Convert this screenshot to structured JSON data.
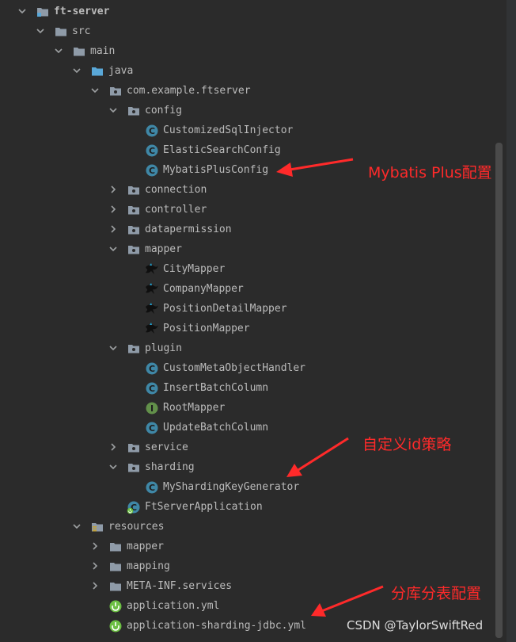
{
  "tree": [
    {
      "label": "ft-server",
      "level": 0,
      "type": "module",
      "expanded": true,
      "bold": true
    },
    {
      "label": "src",
      "level": 1,
      "type": "folder",
      "expanded": true
    },
    {
      "label": "main",
      "level": 2,
      "type": "folder",
      "expanded": true
    },
    {
      "label": "java",
      "level": 3,
      "type": "source-folder",
      "expanded": true
    },
    {
      "label": "com.example.ftserver",
      "level": 4,
      "type": "package",
      "expanded": true
    },
    {
      "label": "config",
      "level": 5,
      "type": "package",
      "expanded": true
    },
    {
      "label": "CustomizedSqlInjector",
      "level": 6,
      "type": "class"
    },
    {
      "label": "ElasticSearchConfig",
      "level": 6,
      "type": "class"
    },
    {
      "label": "MybatisPlusConfig",
      "level": 6,
      "type": "class"
    },
    {
      "label": "connection",
      "level": 5,
      "type": "package",
      "expanded": false
    },
    {
      "label": "controller",
      "level": 5,
      "type": "package",
      "expanded": false
    },
    {
      "label": "datapermission",
      "level": 5,
      "type": "package",
      "expanded": false
    },
    {
      "label": "mapper",
      "level": 5,
      "type": "package",
      "expanded": true
    },
    {
      "label": "CityMapper",
      "level": 6,
      "type": "mybatis"
    },
    {
      "label": "CompanyMapper",
      "level": 6,
      "type": "mybatis"
    },
    {
      "label": "PositionDetailMapper",
      "level": 6,
      "type": "mybatis"
    },
    {
      "label": "PositionMapper",
      "level": 6,
      "type": "mybatis"
    },
    {
      "label": "plugin",
      "level": 5,
      "type": "package",
      "expanded": true
    },
    {
      "label": "CustomMetaObjectHandler",
      "level": 6,
      "type": "class"
    },
    {
      "label": "InsertBatchColumn",
      "level": 6,
      "type": "class"
    },
    {
      "label": "RootMapper",
      "level": 6,
      "type": "interface"
    },
    {
      "label": "UpdateBatchColumn",
      "level": 6,
      "type": "class"
    },
    {
      "label": "service",
      "level": 5,
      "type": "package",
      "expanded": false
    },
    {
      "label": "sharding",
      "level": 5,
      "type": "package",
      "expanded": true
    },
    {
      "label": "MyShardingKeyGenerator",
      "level": 6,
      "type": "class"
    },
    {
      "label": "FtServerApplication",
      "level": 5,
      "type": "spring-app"
    },
    {
      "label": "resources",
      "level": 3,
      "type": "resources",
      "expanded": true
    },
    {
      "label": "mapper",
      "level": 4,
      "type": "folder",
      "expanded": false
    },
    {
      "label": "mapping",
      "level": 4,
      "type": "folder",
      "expanded": false
    },
    {
      "label": "META-INF.services",
      "level": 4,
      "type": "folder",
      "expanded": false
    },
    {
      "label": "application.yml",
      "level": 4,
      "type": "yml"
    },
    {
      "label": "application-sharding-jdbc.yml",
      "level": 4,
      "type": "yml"
    }
  ],
  "annotations": [
    {
      "text": "Mybatis Plus配置",
      "target_row": 8
    },
    {
      "text": "自定义id策略",
      "target_row": 24
    },
    {
      "text": "分库分表配置",
      "target_row": 31
    }
  ],
  "watermark": "CSDN @TaylorSwiftRed",
  "colors": {
    "background": "#2b2b2b",
    "text": "#bbbbbb",
    "folder": "#8f9ba8",
    "source_folder": "#5aa8d8",
    "class_circle": "#3f87a6",
    "interface_circle": "#62904a",
    "spring": "#6cbf43",
    "annotation": "#ff2a2a"
  }
}
